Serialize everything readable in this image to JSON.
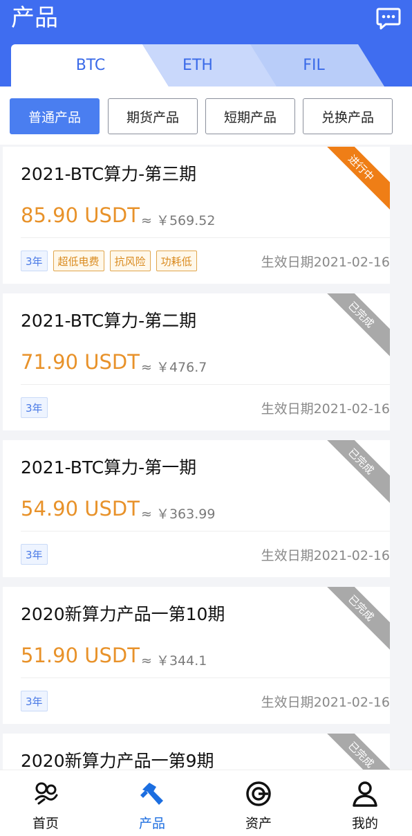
{
  "header": {
    "title": "产品",
    "message_icon": "chat-bubble-icon"
  },
  "coin_tabs": [
    {
      "label": "BTC"
    },
    {
      "label": "ETH"
    },
    {
      "label": "FIL"
    }
  ],
  "filters": [
    {
      "label": "普通产品"
    },
    {
      "label": "期货产品"
    },
    {
      "label": "短期产品"
    },
    {
      "label": "兑换产品"
    }
  ],
  "products": [
    {
      "title": "2021-BTC算力-第三期",
      "price": "85.90 USDT",
      "approx": "≈ ￥569.52",
      "term": "3年",
      "features": [
        "超低电费",
        "抗风险",
        "功耗低"
      ],
      "date": "生效日期2021-02-16",
      "status": "进行中"
    },
    {
      "title": "2021-BTC算力-第二期",
      "price": "71.90 USDT",
      "approx": "≈ ￥476.7",
      "term": "3年",
      "features": [],
      "date": "生效日期2021-02-16",
      "status": "已完成"
    },
    {
      "title": "2021-BTC算力-第一期",
      "price": "54.90 USDT",
      "approx": "≈ ￥363.99",
      "term": "3年",
      "features": [],
      "date": "生效日期2021-02-16",
      "status": "已完成"
    },
    {
      "title": "2020新算力产品一第10期",
      "price": "51.90 USDT",
      "approx": "≈ ￥344.1",
      "term": "3年",
      "features": [],
      "date": "生效日期2021-02-16",
      "status": "已完成"
    },
    {
      "title": "2020新算力产品一第9期",
      "status": "已完成"
    }
  ],
  "nav": [
    {
      "label": "首页",
      "icon": "home-icon"
    },
    {
      "label": "产品",
      "icon": "product-hammer-icon"
    },
    {
      "label": "资产",
      "icon": "asset-icon"
    },
    {
      "label": "我的",
      "icon": "user-icon"
    }
  ],
  "colors": {
    "primary": "#3f6df0",
    "price": "#e8922a",
    "ribbon_active": "#ef7e16",
    "ribbon_done": "#a9a9a9"
  }
}
